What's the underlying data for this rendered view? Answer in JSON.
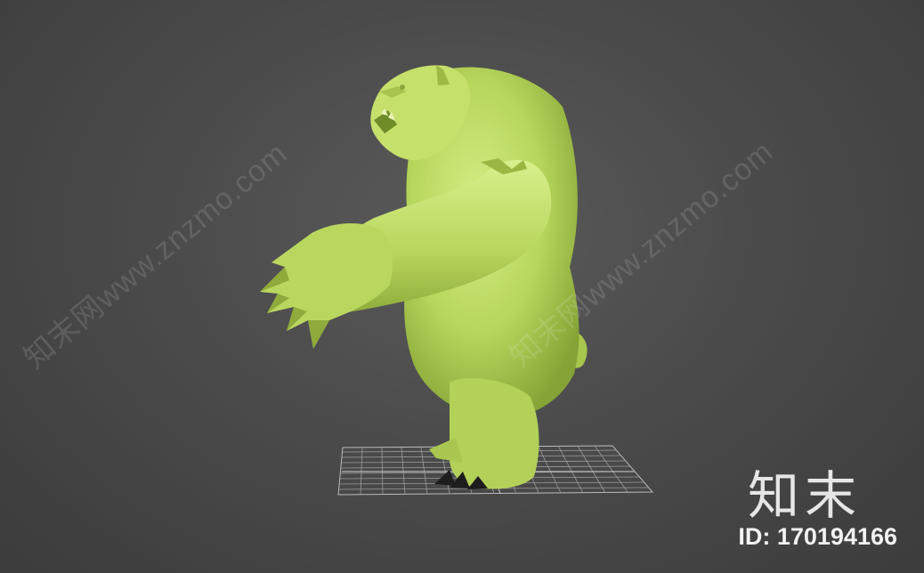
{
  "watermark": {
    "text": "知末网www.znzmo.com"
  },
  "brand": {
    "name": "知末",
    "id_text": "ID: 170194166"
  },
  "colors": {
    "background": "#4a4a4a",
    "model_fill": "#b5d35a",
    "model_highlight": "#d3ec7e",
    "model_shadow": "#7e9c2f",
    "grid": "#9a9a9a"
  },
  "icons": {
    "model": "bear-3d-model",
    "floor": "ground-grid"
  }
}
